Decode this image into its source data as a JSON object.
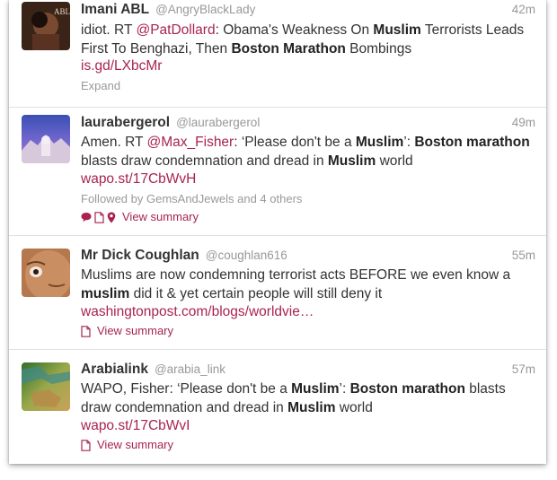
{
  "tweets": [
    {
      "name": "Imani ABL",
      "handle": "@AngryBlackLady",
      "time": "42m",
      "segments": [
        {
          "t": "idiot. RT ",
          "s": "plain"
        },
        {
          "t": "@PatDollard",
          "s": "mention"
        },
        {
          "t": ": Obama's Weakness On ",
          "s": "plain"
        },
        {
          "t": "Muslim",
          "s": "bold"
        },
        {
          "t": " Terrorists Leads First To Benghazi, Then ",
          "s": "plain"
        },
        {
          "t": "Boston Marathon",
          "s": "bold"
        },
        {
          "t": " Bombings",
          "s": "plain"
        }
      ],
      "link": "is.gd/LXbcMr",
      "expand": "Expand"
    },
    {
      "name": "laurabergerol",
      "handle": "@laurabergerol",
      "time": "49m",
      "segments": [
        {
          "t": "Amen. RT ",
          "s": "plain"
        },
        {
          "t": "@Max_Fisher",
          "s": "mention"
        },
        {
          "t": ": ‘Please don't be a ",
          "s": "plain"
        },
        {
          "t": "Muslim",
          "s": "bold"
        },
        {
          "t": "’: ",
          "s": "plain"
        },
        {
          "t": "Boston marathon",
          "s": "bold"
        },
        {
          "t": " blasts draw condemnation and dread in ",
          "s": "plain"
        },
        {
          "t": "Muslim",
          "s": "bold"
        },
        {
          "t": " world",
          "s": "plain"
        }
      ],
      "link": "wapo.st/17CbWvH",
      "followed": "Followed by GemsAndJewels and 4 others",
      "summary": "View summary"
    },
    {
      "name": "Mr Dick Coughlan",
      "handle": "@coughlan616",
      "time": "55m",
      "segments": [
        {
          "t": "Muslims are now condemning terrorist acts BEFORE we even know a ",
          "s": "plain"
        },
        {
          "t": "muslim",
          "s": "bold"
        },
        {
          "t": " did it & yet certain people will still deny it",
          "s": "plain"
        }
      ],
      "link": "washingtonpost.com/blogs/worldvie…",
      "summary": "View summary"
    },
    {
      "name": "Arabialink",
      "handle": "@arabia_link",
      "time": "57m",
      "segments": [
        {
          "t": "WAPO, Fisher: ‘Please don't be a ",
          "s": "plain"
        },
        {
          "t": "Muslim",
          "s": "bold"
        },
        {
          "t": "’: ",
          "s": "plain"
        },
        {
          "t": "Boston marathon",
          "s": "bold"
        },
        {
          "t": " blasts draw condemnation and dread in ",
          "s": "plain"
        },
        {
          "t": "Muslim",
          "s": "bold"
        },
        {
          "t": " world",
          "s": "plain"
        }
      ],
      "link": "wapo.st/17CbWvI",
      "summary": "View summary"
    }
  ],
  "icons": {
    "comment": "speech-bubble-icon",
    "document": "document-icon",
    "location": "location-pin-icon"
  },
  "colors": {
    "link": "#a8244f",
    "text": "#333333",
    "muted": "#999999",
    "divider": "#e1e1e1"
  }
}
